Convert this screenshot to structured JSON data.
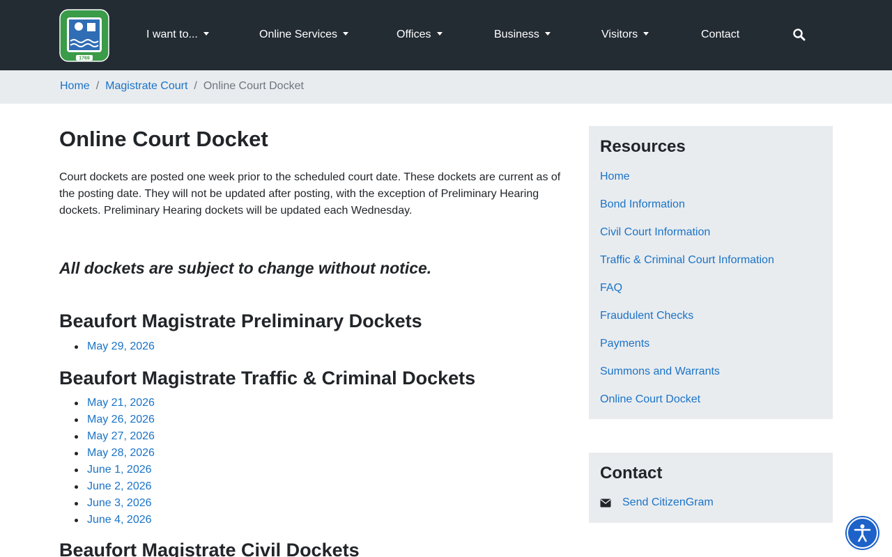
{
  "header": {
    "logo": {
      "top_text": "BEAUFORT COUNTY SOUTH CAROLINA",
      "year": "1769",
      "color": "#3a9b48"
    },
    "nav": [
      {
        "label": "I want to...",
        "dropdown": true
      },
      {
        "label": "Online Services",
        "dropdown": true
      },
      {
        "label": "Offices",
        "dropdown": true
      },
      {
        "label": "Business",
        "dropdown": true
      },
      {
        "label": "Visitors",
        "dropdown": true
      },
      {
        "label": "Contact",
        "dropdown": false
      }
    ],
    "search_icon": "search-icon",
    "background": "#232b33"
  },
  "breadcrumb": {
    "items": [
      "Home",
      "Magistrate Court"
    ],
    "current": "Online Court Docket"
  },
  "main": {
    "title": "Online Court Docket",
    "intro": "Court dockets are posted one week prior to the scheduled court date.  These dockets are current as of the posting date.  They will not be updated after posting, with the exception of Preliminary Hearing dockets.  Preliminary Hearing dockets will be updated each Wednesday.",
    "notice": "All dockets are subject to change without notice.",
    "sections": [
      {
        "heading": "Beaufort Magistrate Preliminary Dockets",
        "dates": [
          "May 29, 2026"
        ]
      },
      {
        "heading": "Beaufort Magistrate Traffic & Criminal Dockets",
        "dates": [
          "May 21, 2026",
          "May 26, 2026",
          "May 27, 2026",
          "May 28, 2026",
          "June 1, 2026",
          "June 2, 2026",
          "June 3, 2026",
          "June 4, 2026"
        ]
      },
      {
        "heading": "Beaufort Magistrate Civil Dockets",
        "dates": []
      }
    ]
  },
  "sidebar": {
    "resources": {
      "heading": "Resources",
      "links": [
        "Home",
        "Bond Information",
        "Civil Court Information",
        "Traffic & Criminal Court Information",
        "FAQ",
        "Fraudulent Checks",
        "Payments",
        "Summons and Warrants",
        "Online Court Docket"
      ]
    },
    "contact": {
      "heading": "Contact",
      "link": "Send CitizenGram",
      "icon": "envelope-icon"
    }
  },
  "accessibility": {
    "icon": "accessibility-icon",
    "color": "#1d62c9"
  },
  "colors": {
    "link": "#1a73c7",
    "panel": "#e9ecef"
  }
}
